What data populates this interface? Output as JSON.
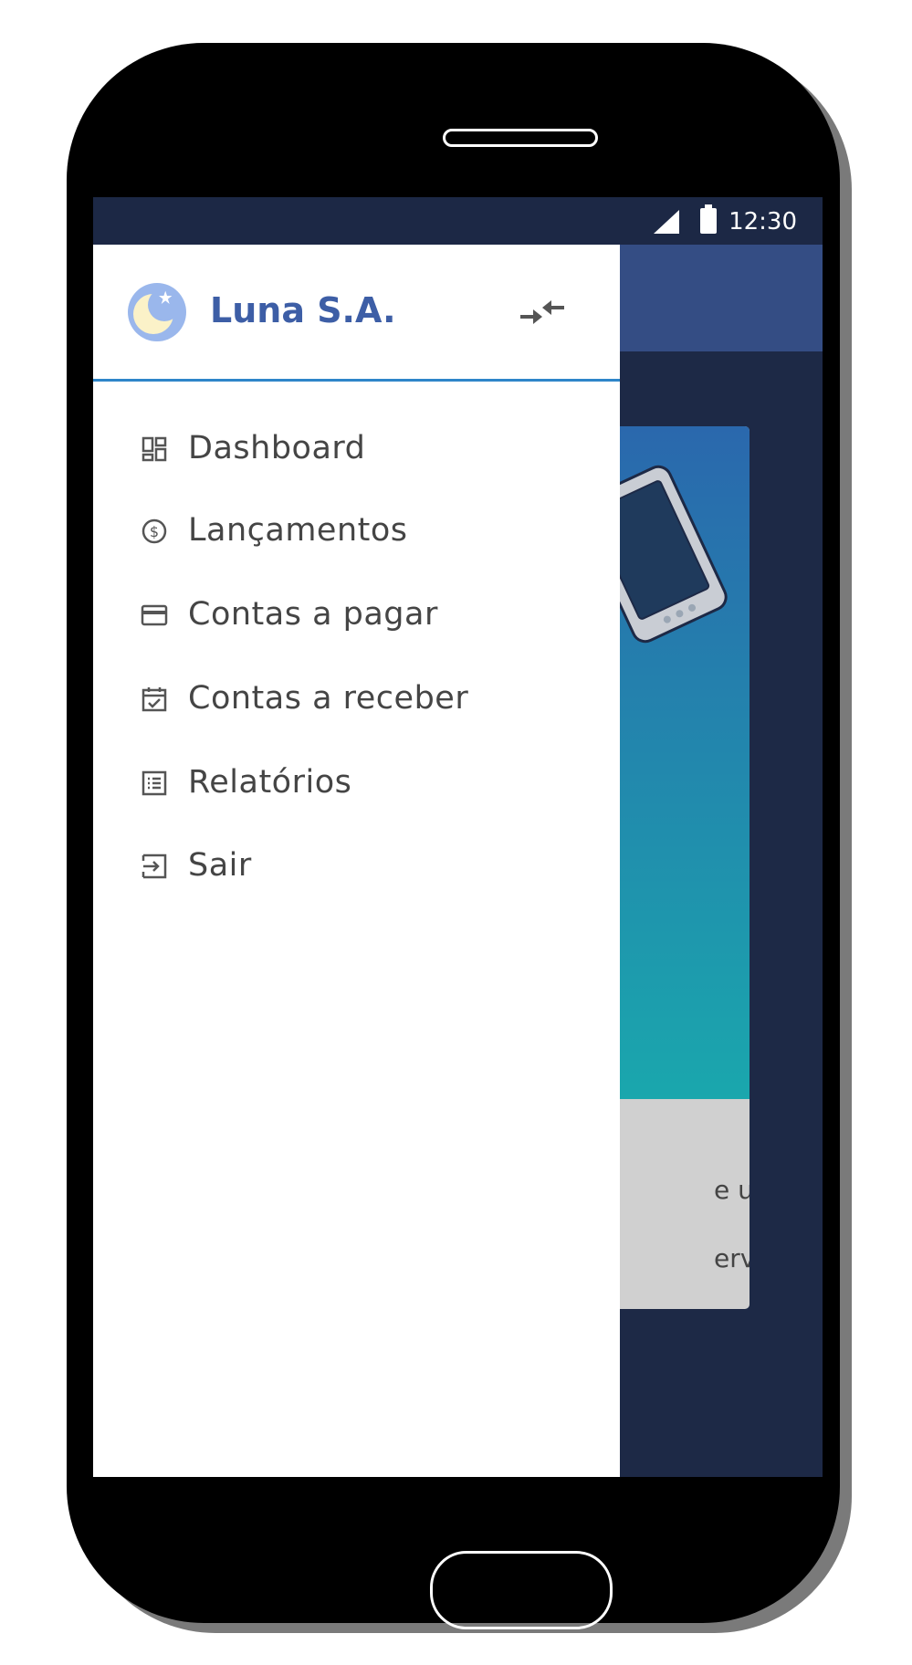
{
  "status": {
    "time": "12:30"
  },
  "drawer": {
    "brand": "Luna S.A.",
    "menu": [
      {
        "label": "Dashboard",
        "icon": "dashboard-icon"
      },
      {
        "label": "Lançamentos",
        "icon": "dollar-circle-icon"
      },
      {
        "label": "Contas a pagar",
        "icon": "credit-card-icon"
      },
      {
        "label": "Contas a receber",
        "icon": "calendar-check-icon"
      },
      {
        "label": "Relatórios",
        "icon": "list-icon"
      },
      {
        "label": "Sair",
        "icon": "logout-icon"
      }
    ]
  },
  "card": {
    "line1": "e uma",
    "line2": "erviços."
  },
  "colors": {
    "screen_bg": "#1d2946",
    "appbar": "#344d84",
    "brand": "#3d5ea6",
    "divider": "#2e86c9"
  }
}
